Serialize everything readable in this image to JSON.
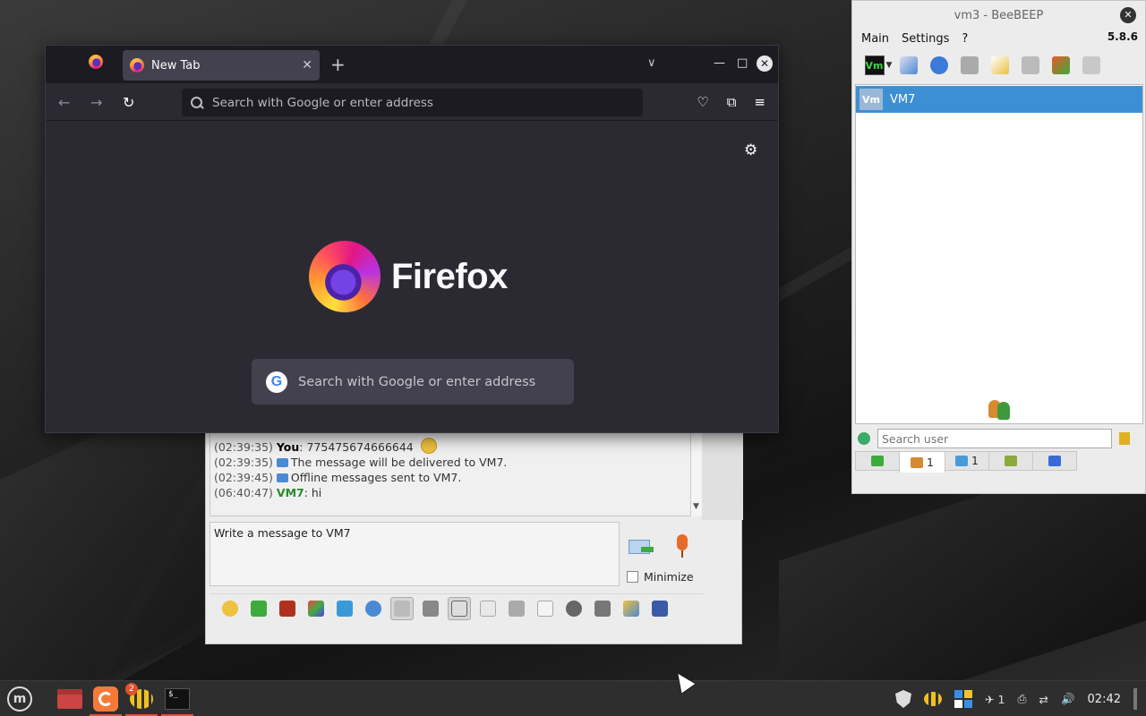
{
  "firefox": {
    "tab_title": "New Tab",
    "tab_close": "✕",
    "new_tab": "+",
    "list_tabs": "∨",
    "win_min": "—",
    "win_max": "□",
    "win_close": "✕",
    "nav_back": "←",
    "nav_forward": "→",
    "nav_reload": "↻",
    "url_placeholder": "Search with Google or enter address",
    "settings_icon": "⚙",
    "brand": "Firefox",
    "content_search_placeholder": "Search with Google or enter address",
    "google_letter": "G"
  },
  "chat": {
    "messages": [
      {
        "time": "(02:39:35)",
        "sender": "You",
        "text": ": 775475674666644"
      },
      {
        "time": "(02:39:35)",
        "sender": "",
        "text": "The message will be delivered to VM7."
      },
      {
        "time": "(02:39:45)",
        "sender": "",
        "text": "Offline messages sent to VM7."
      },
      {
        "time": "(06:40:47)",
        "sender": "VM7",
        "text": ": hi"
      }
    ],
    "input_placeholder": "Write a message to VM7",
    "minimize_label": "Minimize",
    "scroll_down": "▼"
  },
  "beebeep": {
    "title": "vm3 - BeeBEEP",
    "close": "✕",
    "menu": [
      "Main",
      "Settings",
      "?"
    ],
    "version": "5.8.6",
    "status_label": "Vm",
    "users": [
      {
        "avatar": "Vm",
        "name": "VM7"
      }
    ],
    "search_placeholder": "Search user",
    "tabs": [
      {
        "count": ""
      },
      {
        "count": "1"
      },
      {
        "count": "1"
      },
      {
        "count": ""
      },
      {
        "count": ""
      }
    ]
  },
  "taskbar": {
    "menu_label": "m",
    "beebeep_badge": "2",
    "terminal_label": "$_",
    "notifications_count": "1",
    "clock": "02:42"
  },
  "colors": {
    "firefox_bg": "#2b2a33",
    "firefox_tabbar": "#1c1b22",
    "beebeep_selected": "#3d8fd4",
    "vm7_green": "#2a8a2a",
    "taskbar": "#2e2e2e"
  }
}
